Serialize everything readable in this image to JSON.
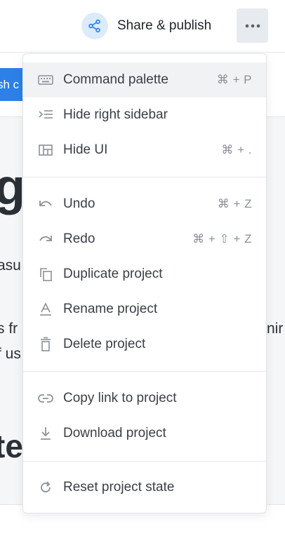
{
  "header": {
    "share_label": "Share & publish",
    "share_icon": "share-icon",
    "more_icon": "more-horizontal-icon"
  },
  "background": {
    "button_text": "sh c",
    "heading1": "g",
    "line1": "asu",
    "line2": "s fr",
    "line3": "f us",
    "right_text": "nir",
    "heading2": "te"
  },
  "menu": {
    "items": [
      {
        "label": "Command palette",
        "shortcut": "⌘ + P",
        "icon": "keyboard-icon"
      },
      {
        "label": "Hide right sidebar",
        "shortcut": "",
        "icon": "indent-list-icon"
      },
      {
        "label": "Hide UI",
        "shortcut": "⌘ + .",
        "icon": "layout-icon"
      },
      {
        "label": "Undo",
        "shortcut": "⌘ + Z",
        "icon": "undo-icon"
      },
      {
        "label": "Redo",
        "shortcut": "⌘ + ⇧ + Z",
        "icon": "redo-icon"
      },
      {
        "label": "Duplicate project",
        "shortcut": "",
        "icon": "duplicate-icon"
      },
      {
        "label": "Rename project",
        "shortcut": "",
        "icon": "rename-icon"
      },
      {
        "label": "Delete project",
        "shortcut": "",
        "icon": "trash-icon"
      },
      {
        "label": "Copy link to project",
        "shortcut": "",
        "icon": "link-icon"
      },
      {
        "label": "Download project",
        "shortcut": "",
        "icon": "download-icon"
      },
      {
        "label": "Reset project state",
        "shortcut": "",
        "icon": "refresh-icon"
      }
    ]
  },
  "colors": {
    "accent": "#2c80e8",
    "icon": "#8a9099",
    "text": "#3a3f46"
  }
}
